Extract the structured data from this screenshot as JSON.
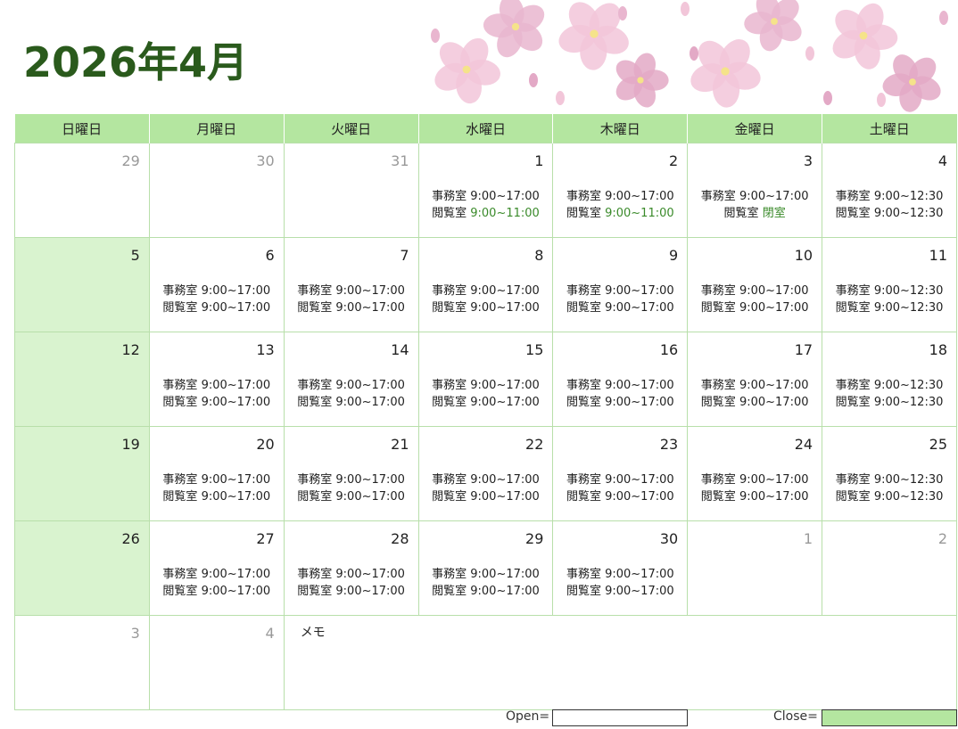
{
  "title": "2026年4月",
  "colors": {
    "header": "#b4e6a0",
    "closed": "#d9f3cf",
    "title": "#2a5a1c",
    "highlight": "#3a8a2a"
  },
  "weekdays": [
    "日曜日",
    "月曜日",
    "火曜日",
    "水曜日",
    "木曜日",
    "金曜日",
    "土曜日"
  ],
  "labels": {
    "office": "事務室",
    "reading": "閲覧室"
  },
  "weeks": [
    [
      {
        "day": "29",
        "dim": true
      },
      {
        "day": "30",
        "dim": true
      },
      {
        "day": "31",
        "dim": true
      },
      {
        "day": "1",
        "office": "9:00~17:00",
        "reading": "9:00~11:00",
        "reading_highlight": true
      },
      {
        "day": "2",
        "office": "9:00~17:00",
        "reading": "9:00~11:00",
        "reading_highlight": true
      },
      {
        "day": "3",
        "office": "9:00~17:00",
        "reading": "閉室",
        "reading_highlight": true
      },
      {
        "day": "4",
        "office": "9:00~12:30",
        "reading": "9:00~12:30"
      }
    ],
    [
      {
        "day": "5",
        "closed": true
      },
      {
        "day": "6",
        "office": "9:00~17:00",
        "reading": "9:00~17:00"
      },
      {
        "day": "7",
        "office": "9:00~17:00",
        "reading": "9:00~17:00"
      },
      {
        "day": "8",
        "office": "9:00~17:00",
        "reading": "9:00~17:00"
      },
      {
        "day": "9",
        "office": "9:00~17:00",
        "reading": "9:00~17:00"
      },
      {
        "day": "10",
        "office": "9:00~17:00",
        "reading": "9:00~17:00"
      },
      {
        "day": "11",
        "office": "9:00~12:30",
        "reading": "9:00~12:30"
      }
    ],
    [
      {
        "day": "12",
        "closed": true
      },
      {
        "day": "13",
        "office": "9:00~17:00",
        "reading": "9:00~17:00"
      },
      {
        "day": "14",
        "office": "9:00~17:00",
        "reading": "9:00~17:00"
      },
      {
        "day": "15",
        "office": "9:00~17:00",
        "reading": "9:00~17:00"
      },
      {
        "day": "16",
        "office": "9:00~17:00",
        "reading": "9:00~17:00"
      },
      {
        "day": "17",
        "office": "9:00~17:00",
        "reading": "9:00~17:00"
      },
      {
        "day": "18",
        "office": "9:00~12:30",
        "reading": "9:00~12:30"
      }
    ],
    [
      {
        "day": "19",
        "closed": true
      },
      {
        "day": "20",
        "office": "9:00~17:00",
        "reading": "9:00~17:00"
      },
      {
        "day": "21",
        "office": "9:00~17:00",
        "reading": "9:00~17:00"
      },
      {
        "day": "22",
        "office": "9:00~17:00",
        "reading": "9:00~17:00"
      },
      {
        "day": "23",
        "office": "9:00~17:00",
        "reading": "9:00~17:00"
      },
      {
        "day": "24",
        "office": "9:00~17:00",
        "reading": "9:00~17:00"
      },
      {
        "day": "25",
        "office": "9:00~12:30",
        "reading": "9:00~12:30"
      }
    ],
    [
      {
        "day": "26",
        "closed": true
      },
      {
        "day": "27",
        "office": "9:00~17:00",
        "reading": "9:00~17:00"
      },
      {
        "day": "28",
        "office": "9:00~17:00",
        "reading": "9:00~17:00"
      },
      {
        "day": "29",
        "office": "9:00~17:00",
        "reading": "9:00~17:00"
      },
      {
        "day": "30",
        "office": "9:00~17:00",
        "reading": "9:00~17:00"
      },
      {
        "day": "1",
        "dim": true
      },
      {
        "day": "2",
        "dim": true
      }
    ]
  ],
  "last_week": [
    {
      "day": "3",
      "dim": true
    },
    {
      "day": "4",
      "dim": true
    }
  ],
  "memo_label": "メモ",
  "legend": {
    "open_label": "Open=",
    "close_label": "Close="
  }
}
